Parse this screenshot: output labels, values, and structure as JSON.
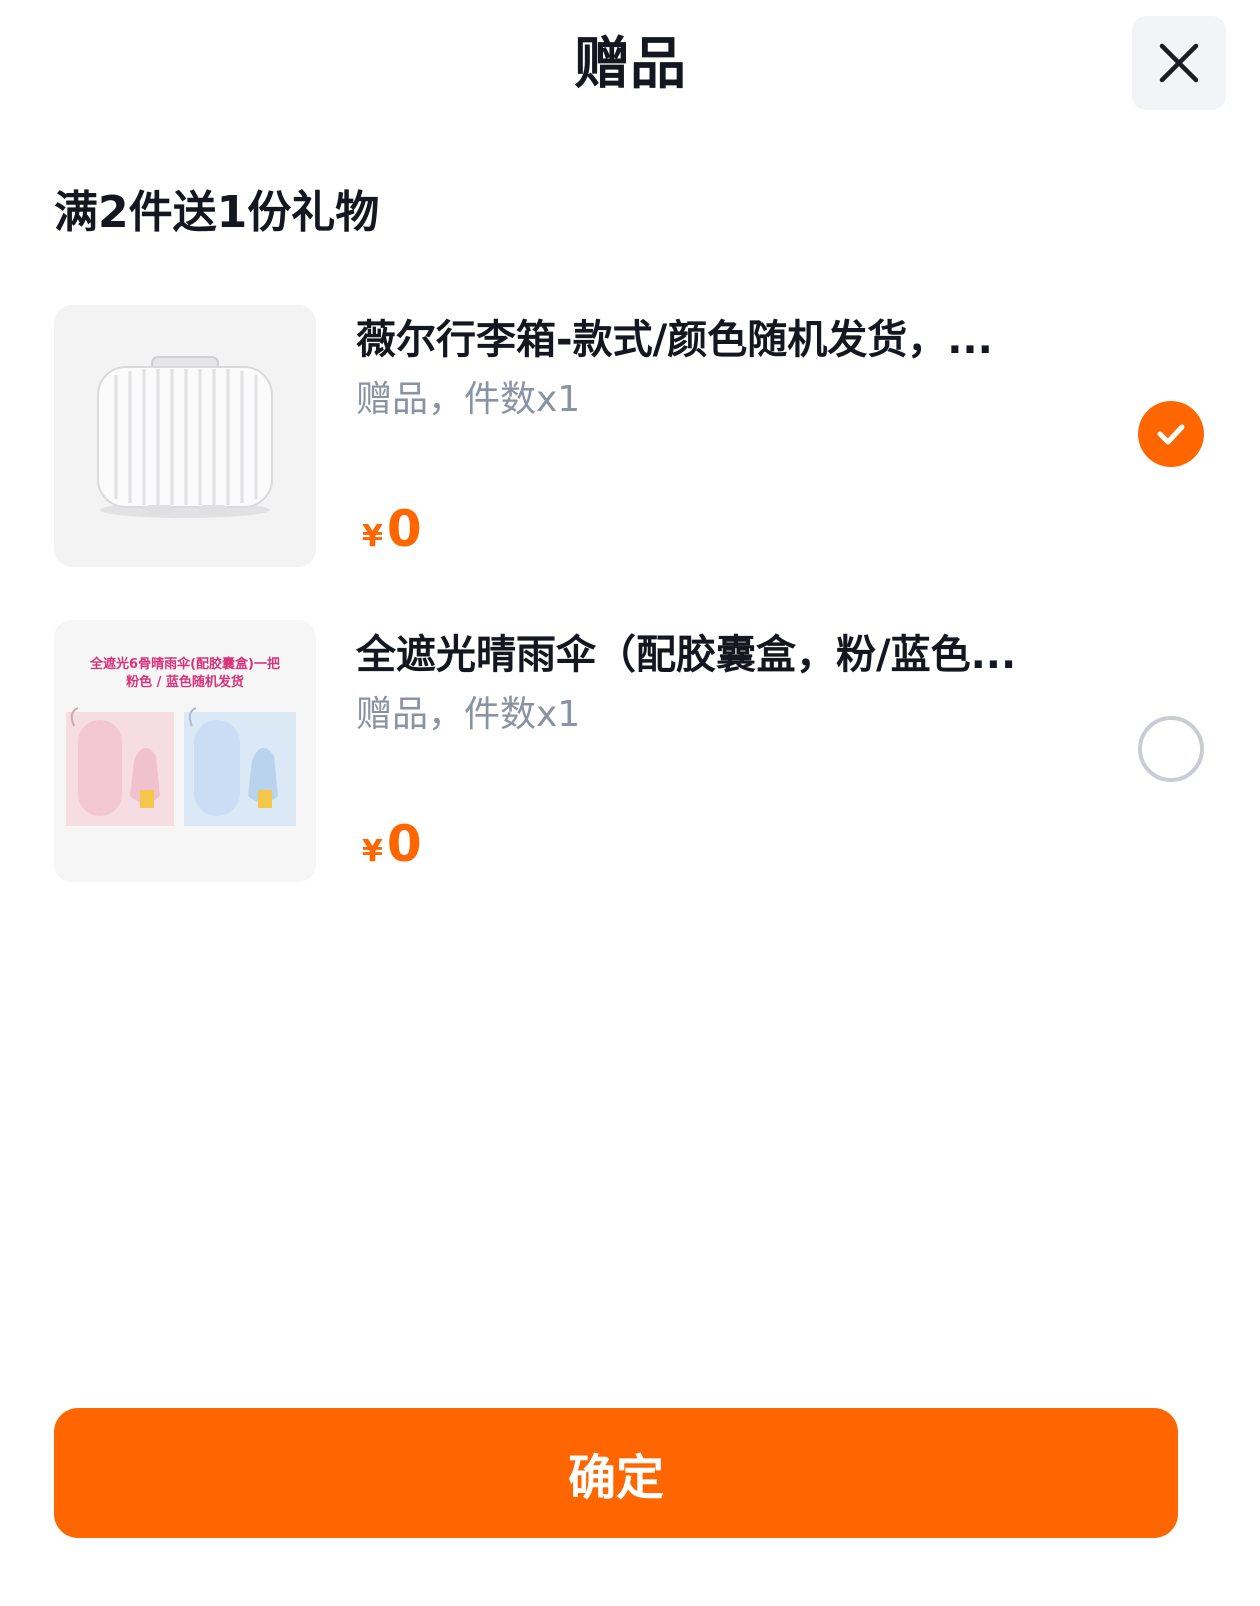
{
  "header": {
    "title": "赠品",
    "close_icon": "close-icon"
  },
  "promo": {
    "title": "满2件送1份礼物"
  },
  "gifts": [
    {
      "name": "薇尔行李箱-款式/颜色随机发货，...",
      "meta": "赠品，件数x1",
      "price_symbol": "¥",
      "price": "0",
      "selected": true,
      "image_icon": "suitcase-image"
    },
    {
      "name": "全遮光晴雨伞（配胶囊盒，粉/蓝色...",
      "meta": "赠品，件数x1",
      "price_symbol": "¥",
      "price": "0",
      "selected": false,
      "image_icon": "umbrella-image",
      "image_caption_line1": "全遮光6骨晴雨伞(配胶囊盒)一把",
      "image_caption_line2": "粉色 / 蓝色随机发货"
    }
  ],
  "footer": {
    "confirm_label": "确定"
  },
  "colors": {
    "accent": "#ff6600",
    "text_primary": "#14171f",
    "text_secondary": "#8a93a3",
    "radio_border": "#c9ccd3"
  }
}
